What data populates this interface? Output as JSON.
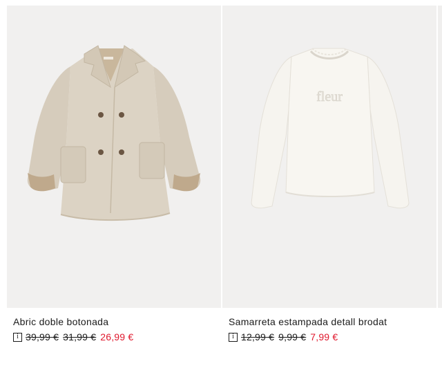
{
  "products": [
    {
      "title": "Abric doble botonada",
      "info_icon": "i",
      "price_original": "39,99 €",
      "price_previous": "31,99 €",
      "price_sale": "26,99 €",
      "image_icon": "coat-image"
    },
    {
      "title": "Samarreta estampada detall brodat",
      "info_icon": "i",
      "price_original": "12,99 €",
      "price_previous": "9,99 €",
      "price_sale": "7,99 €",
      "image_icon": "tshirt-image",
      "print_text": "fleur"
    }
  ],
  "colors": {
    "sale": "#e0182d",
    "image_bg": "#f1f0ef",
    "coat": "#d8cfc0",
    "shirt": "#f7f5f0"
  }
}
